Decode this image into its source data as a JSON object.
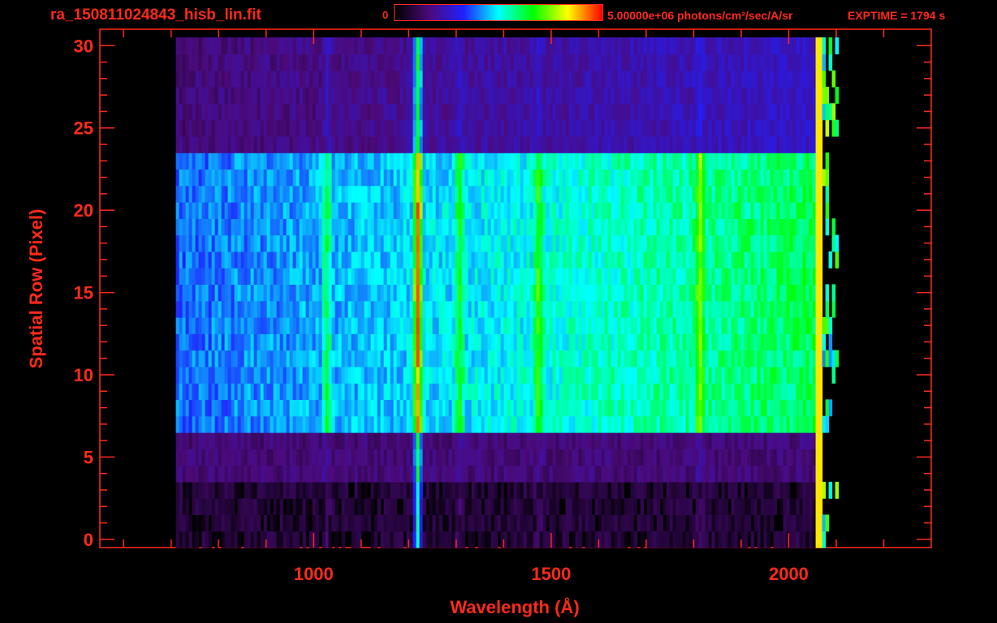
{
  "header": {
    "file_name": "ra_150811024843_hisb_lin.fit",
    "colorbar_min_label": "0",
    "colorbar_max_label": "5.00000e+06 photons/cm²/sec/A/sr",
    "exptime_label": "EXPTIME = 1794 s"
  },
  "colors": {
    "axis": "#ff2a1a",
    "background": "#000000",
    "colormap": [
      "#000000",
      "#4b0a7a",
      "#2020ff",
      "#00ffff",
      "#00ff00",
      "#ffff00",
      "#ff0000"
    ]
  },
  "chart_data": {
    "type": "heatmap",
    "xlabel": "Wavelength (Å)",
    "ylabel": "Spatial Row (Pixel)",
    "xlim": [
      550,
      2300
    ],
    "ylim": [
      -0.5,
      31
    ],
    "x_ticks": [
      1000,
      1500,
      2000
    ],
    "y_ticks": [
      0,
      5,
      10,
      15,
      20,
      25,
      30
    ],
    "colorbar_range": [
      0,
      5000000
    ],
    "colorbar_unit": "photons/cm²/sec/A/sr",
    "emission_lines_angstrom": [
      1025,
      1216,
      1304,
      1470,
      1810
    ],
    "slit_rows": [
      7,
      23
    ],
    "detector_wavelength_range": [
      720,
      2060
    ]
  }
}
